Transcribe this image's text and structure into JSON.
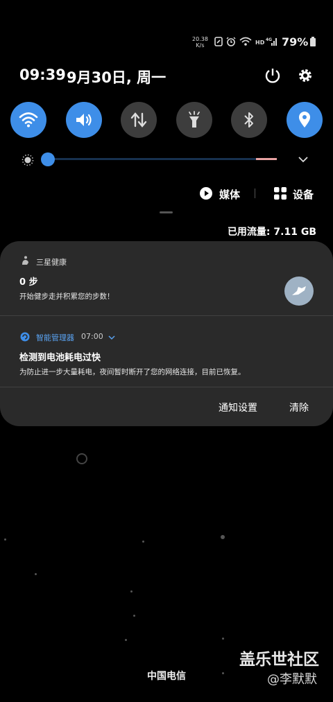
{
  "status_bar": {
    "net_speed_value": "20.38",
    "net_speed_unit": "K/s",
    "battery_percent": "79%",
    "icons": [
      "data-saver-icon",
      "alarm-icon",
      "wifi-icon",
      "hd-icon",
      "4g-signal-icon",
      "battery-icon"
    ]
  },
  "header": {
    "time": "09:39",
    "date": "9月30日, 周一",
    "icons": [
      "power-icon",
      "settings-icon"
    ]
  },
  "quick_settings": [
    {
      "name": "wifi",
      "icon": "wifi-icon",
      "on": true
    },
    {
      "name": "sound",
      "icon": "speaker-icon",
      "on": true
    },
    {
      "name": "mobile-data",
      "icon": "data-transfer-icon",
      "on": false
    },
    {
      "name": "flashlight",
      "icon": "flashlight-icon",
      "on": false
    },
    {
      "name": "bluetooth",
      "icon": "bluetooth-icon",
      "on": false
    },
    {
      "name": "location",
      "icon": "location-icon",
      "on": true
    }
  ],
  "brightness": {
    "level": 0.05
  },
  "media_bar": {
    "media_label": "媒体",
    "devices_label": "设备"
  },
  "data_usage": "已用流量: 7.11 GB",
  "notifications": [
    {
      "app": "三星健康",
      "title": "0 步",
      "body": "开始健步走并积累您的步数！"
    },
    {
      "app": "智能管理器",
      "time": "07:00",
      "title": "检测到电池耗电过快",
      "body": "为防止进一步大量耗电，夜间暂时断开了您的网络连接，目前已恢复。"
    }
  ],
  "actions": {
    "settings_label": "通知设置",
    "clear_label": "清除"
  },
  "carrier": "中国电信",
  "watermark": {
    "line1": "盖乐世社区",
    "line2": "@李默默"
  },
  "colors": {
    "accent": "#3e8ee8",
    "card": "#2a2a2a",
    "toggle_off": "#3d3d3d"
  }
}
